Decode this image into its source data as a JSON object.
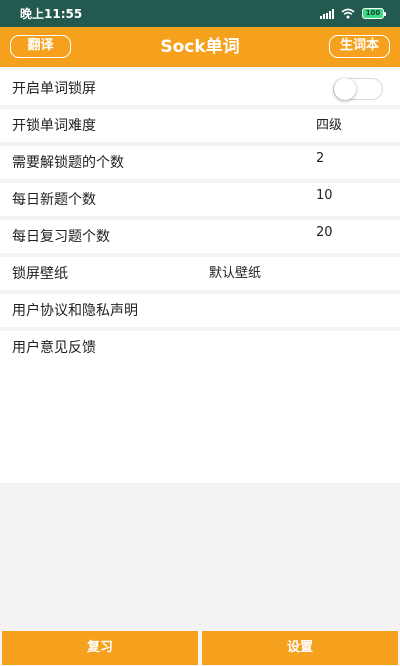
{
  "status_bar": {
    "time": "晚上11:55",
    "battery": "100"
  },
  "header": {
    "title": "Sock单词",
    "left_button": "翻译",
    "right_button": "生词本"
  },
  "settings": {
    "lockscreen_toggle": {
      "label": "开启单词锁屏",
      "enabled": false
    },
    "difficulty": {
      "label": "开锁单词难度",
      "value": "四级"
    },
    "unlock_count": {
      "label": "需要解锁题的个数",
      "value": "2"
    },
    "daily_new": {
      "label": "每日新题个数",
      "value": "10"
    },
    "daily_review": {
      "label": "每日复习题个数",
      "value": "20"
    },
    "wallpaper": {
      "label": "锁屏壁纸",
      "value": "默认壁纸"
    },
    "privacy": {
      "label": "用户协议和隐私声明"
    },
    "feedback": {
      "label": "用户意见反馈"
    }
  },
  "bottom_tabs": {
    "review": "复习",
    "settings": "设置"
  },
  "colors": {
    "accent": "#f5a11d",
    "status_bar": "#23594f",
    "background": "#f3f3f3"
  },
  "icons": [
    "signal-icon",
    "wifi-icon",
    "battery-icon"
  ]
}
